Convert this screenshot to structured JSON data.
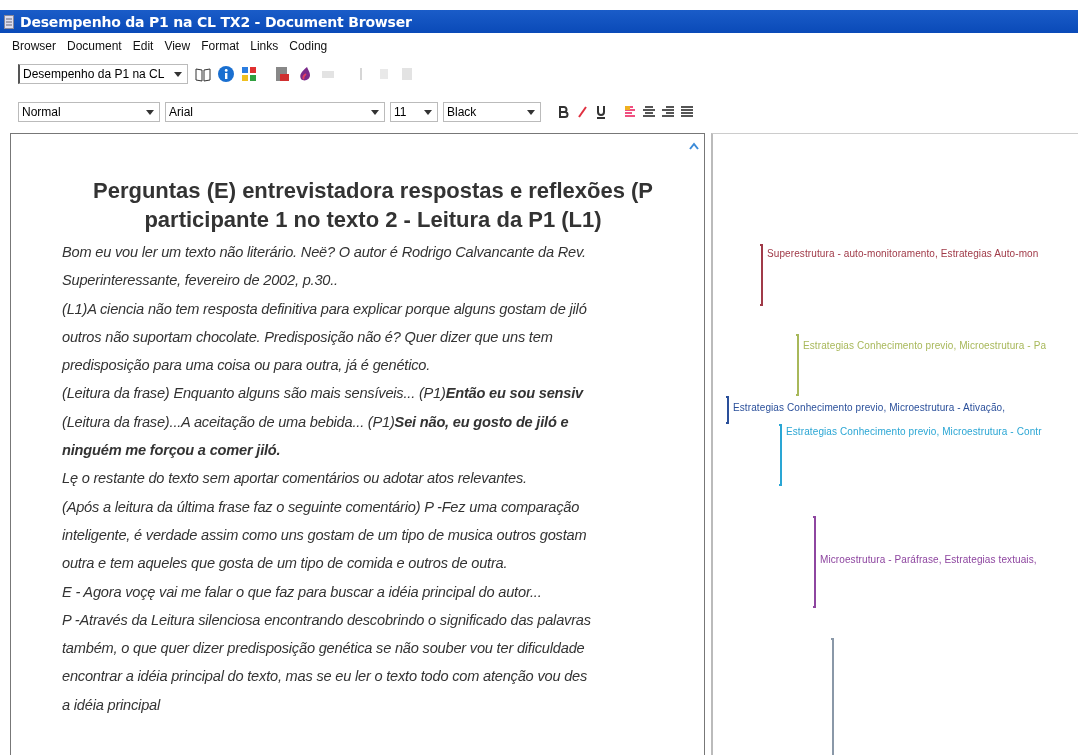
{
  "window": {
    "title": "Desempenho da P1 na CL TX2 - Document Browser"
  },
  "menu": [
    "Browser",
    "Document",
    "Edit",
    "View",
    "Format",
    "Links",
    "Coding"
  ],
  "toolbar": {
    "document": "Desempenho da P1 na CL"
  },
  "format_bar": {
    "style": "Normal",
    "font": "Arial",
    "size": "11",
    "text_color": "Black"
  },
  "document": {
    "heading": [
      "Perguntas (E) entrevistadora respostas e reflexões (P",
      "participante 1 no texto 2 - Leitura da P1 (L1)"
    ],
    "lines": [
      {
        "text": "Bom eu vou ler um texto não literário. Neë?  O autor é Rodrigo Calvancante da Rev.",
        "bold": false
      },
      {
        "text": "Superinteressante, fevereiro de 2002, p.30..",
        "bold": false
      },
      {
        "text": "(L1)A ciencia não tem resposta definitiva para explicar porque alguns gostam de jiló",
        "bold": false
      },
      {
        "text": "outros não suportam chocolate. Predisposição não é? Quer dizer que uns tem",
        "bold": false
      },
      {
        "text": "predisposição para uma coisa ou para outra, já é genético.",
        "bold": false
      },
      {
        "text": "(Leitura da frase) Enquanto alguns são mais sensíveis... (P1)**Então eu sou sensiv**",
        "bold": false
      },
      {
        "text": "(Leitura da frase)...A aceitação de uma bebida... (P1)**Sei não, eu gosto de jiló e**",
        "bold": false
      },
      {
        "text": "ninguém me forçou a comer jiló.",
        "bold": true
      },
      {
        "text": "Lę o restante do texto sem aportar comentários ou adotar atos relevantes.",
        "bold": false
      },
      {
        "text": "(Após a leitura da última frase faz o seguinte comentário)  P -Fez uma comparação",
        "bold": false
      },
      {
        "text": "inteligente, é verdade assim como uns gostam de um tipo de musica outros gostam",
        "bold": false
      },
      {
        "text": "outra e tem aqueles que gosta de um tipo de comida e outros de outra.",
        "bold": false
      },
      {
        "text": "E - Agora voçę vai me falar o que faz para buscar a idéia principal do autor...",
        "bold": false
      },
      {
        "text": "P -Através da Leitura silenciosa encontrando descobrindo o significado das palavras",
        "bold": false
      },
      {
        "text": "também, o que quer dizer predisposição genética se não souber vou ter dificuldade",
        "bold": false
      },
      {
        "text": "encontrar a idéia principal do texto, mas se eu ler o texto todo com atenção vou des",
        "bold": false
      },
      {
        "text": "a idéia principal",
        "bold": false
      }
    ]
  },
  "codes": [
    {
      "label": "Superestrutura - auto-monitoramento, Estrategias Auto-mon",
      "color": "#a03a48"
    },
    {
      "label": "Estrategias Conhecimento previo, Microestrutura - Pa",
      "color": "#a8b85a"
    },
    {
      "label": "Estrategias Conhecimento previo, Microestrutura - Ativação,",
      "color": "#2a4f9a"
    },
    {
      "label": "Estrategias Conhecimento previo, Microestrutura - Contr",
      "color": "#2aa6d4"
    },
    {
      "label": "Microestrutura - Paráfrase, Estrategias textuais,",
      "color": "#8e46a0"
    },
    {
      "color": "#8a98a8"
    }
  ]
}
